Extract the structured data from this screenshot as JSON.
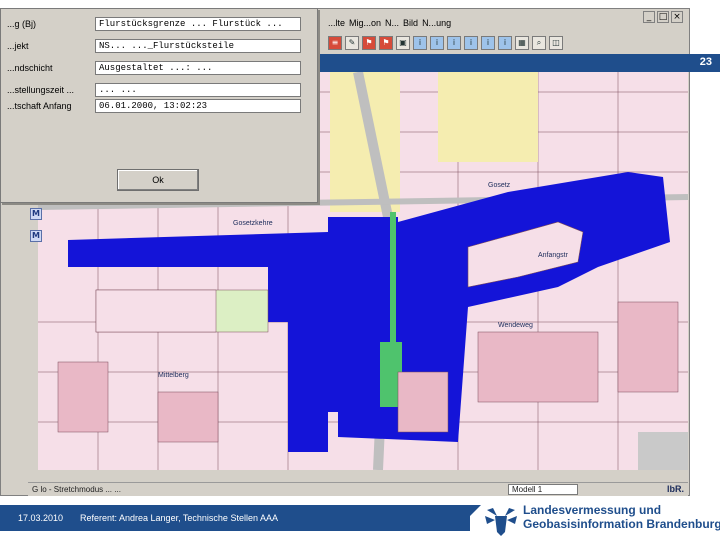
{
  "slide": {
    "number": "23",
    "footer_date": "17.03.2010",
    "footer_referent": "Referent: Andrea Langer, Technische Stellen AAA",
    "org_line1": "Landesvermessung und",
    "org_line2": "Geobasisinformation Brandenburg",
    "band_color": "#1f4e8c"
  },
  "app": {
    "menu": [
      "...lte",
      "Mig...on",
      "N...",
      "Bild",
      "N...ung"
    ],
    "window_controls": [
      "_",
      "□",
      "×"
    ],
    "toolbar_icons": [
      "layer-icon",
      "edit-icon",
      "flag-icon",
      "flag-icon",
      "select-icon",
      "info-icon",
      "table-icon",
      "zoom-icon",
      "map-icon"
    ],
    "side_tools": [
      "M",
      "M"
    ],
    "status_text": "G lo - Stretchmodus ... ...",
    "status_scale": "Modell 1",
    "status_logo": "lbR."
  },
  "dialog": {
    "rows": [
      {
        "label": "...g (Bj)",
        "value": "Flurstücksgrenze ... Flurstück ..."
      },
      {
        "label": "...jekt",
        "value": "NS... ..._Flurstücksteile"
      },
      {
        "label": "...ndschicht",
        "value": "Ausgestaltet ...: ..."
      },
      {
        "label": "...stellungszeit ...",
        "value": "... ..."
      },
      {
        "label": "...tschaft Anfang",
        "value": "06.01.2000, 13:02:23"
      }
    ],
    "ok_label": "Ok"
  },
  "map": {
    "labels": [
      "Gosetzkehre",
      "Gosetz",
      "Anfangstr",
      "Wendeweg",
      "Mittelberg"
    ],
    "colors": {
      "background": "#f6dfe8",
      "water": "#1414d8",
      "green": "#4fc36d",
      "road": "#bfbfbf",
      "yellow": "#f5edb0",
      "garden": "#dcefc4"
    }
  }
}
